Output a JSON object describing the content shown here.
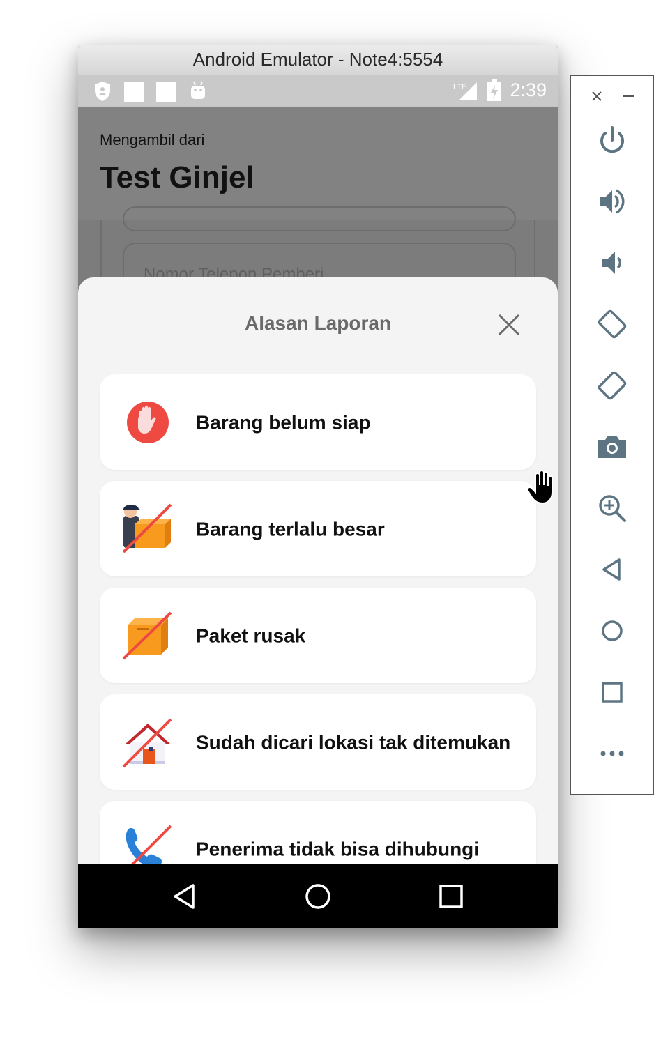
{
  "window": {
    "title": "Android Emulator - Note4:5554"
  },
  "status_bar": {
    "time": "2:39",
    "network": "LTE"
  },
  "app_bar": {
    "subtitle": "Mengambil dari",
    "title": "Test Ginjel"
  },
  "background_form": {
    "phone_placeholder": "Nomor Telepon Pemberi"
  },
  "sheet": {
    "title": "Alasan Laporan",
    "reasons": [
      {
        "label": "Barang belum siap",
        "icon": "stop-hand-icon"
      },
      {
        "label": "Barang terlalu besar",
        "icon": "courier-box-crossed-icon"
      },
      {
        "label": "Paket rusak",
        "icon": "box-crossed-icon"
      },
      {
        "label": "Sudah dicari lokasi tak ditemukan",
        "icon": "house-crossed-icon"
      },
      {
        "label": "Penerima tidak bisa dihubungi",
        "icon": "phone-crossed-icon"
      }
    ]
  },
  "colors": {
    "accent_red": "#ef4a41",
    "box_orange": "#f79a1d",
    "phone_blue": "#2a7fd6"
  },
  "toolbar": {
    "buttons": [
      "power-icon",
      "volume-up-icon",
      "volume-down-icon",
      "rotate-left-icon",
      "rotate-right-icon",
      "camera-icon",
      "zoom-icon",
      "back-icon",
      "home-icon",
      "overview-icon",
      "more-icon"
    ]
  }
}
